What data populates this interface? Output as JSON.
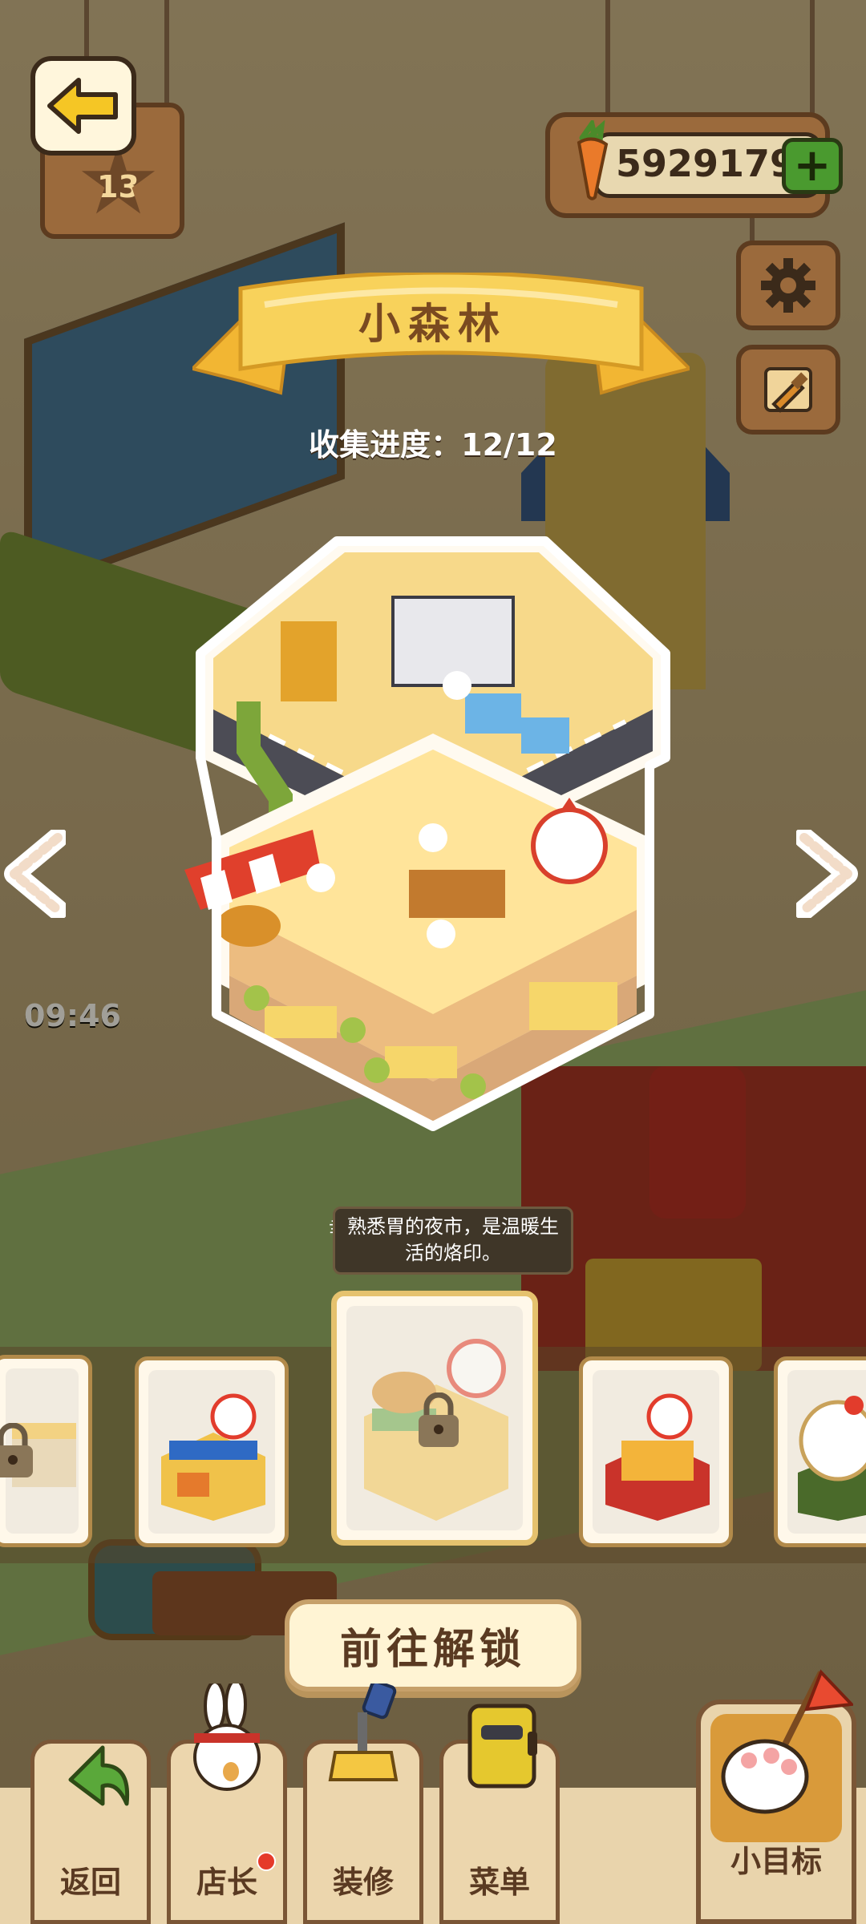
{
  "hud": {
    "level": "13",
    "coins": "5929179",
    "plus_label": "+"
  },
  "banner": {
    "title": "小森林",
    "progress": "收集进度：12/12"
  },
  "scene": {
    "clock": "09:46",
    "tooltip_text": "熟悉胃的夜市，是温暖生活的烙印。",
    "tooltip_peek": "幸"
  },
  "cards": [
    {
      "name": "shop-card-1",
      "locked": true
    },
    {
      "name": "shop-card-2",
      "locked": false
    },
    {
      "name": "shop-card-3",
      "locked": true,
      "selected": true
    },
    {
      "name": "shop-card-4",
      "locked": false
    },
    {
      "name": "shop-card-5",
      "locked": false
    }
  ],
  "unlock_button": "前往解锁",
  "nav": {
    "back": "返回",
    "manager": "店长",
    "decorate": "装修",
    "menu": "菜单",
    "goals": "小目标"
  },
  "colors": {
    "banner": "#f5c94a",
    "accent_green": "#4a9a2f",
    "wood": "#9b6a3c",
    "notification": "#e53a2a"
  }
}
